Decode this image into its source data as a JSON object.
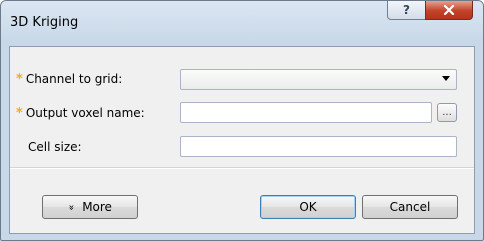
{
  "window": {
    "title": "3D Kriging"
  },
  "titlebar": {
    "help_glyph": "?",
    "close_glyph": "x"
  },
  "form": {
    "channel_label": "Channel to grid:",
    "channel_value": "",
    "output_label": "Output voxel name:",
    "output_value": "",
    "browse_label": "...",
    "cell_label": "Cell size:",
    "cell_value": "",
    "required_marker": "*"
  },
  "buttons": {
    "more_label": "More",
    "more_glyph": "»",
    "ok_label": "OK",
    "cancel_label": "Cancel"
  },
  "colors": {
    "required_star": "#f5a623",
    "close_button": "#c2422a",
    "dialog_bg": "#f0f0f0"
  }
}
